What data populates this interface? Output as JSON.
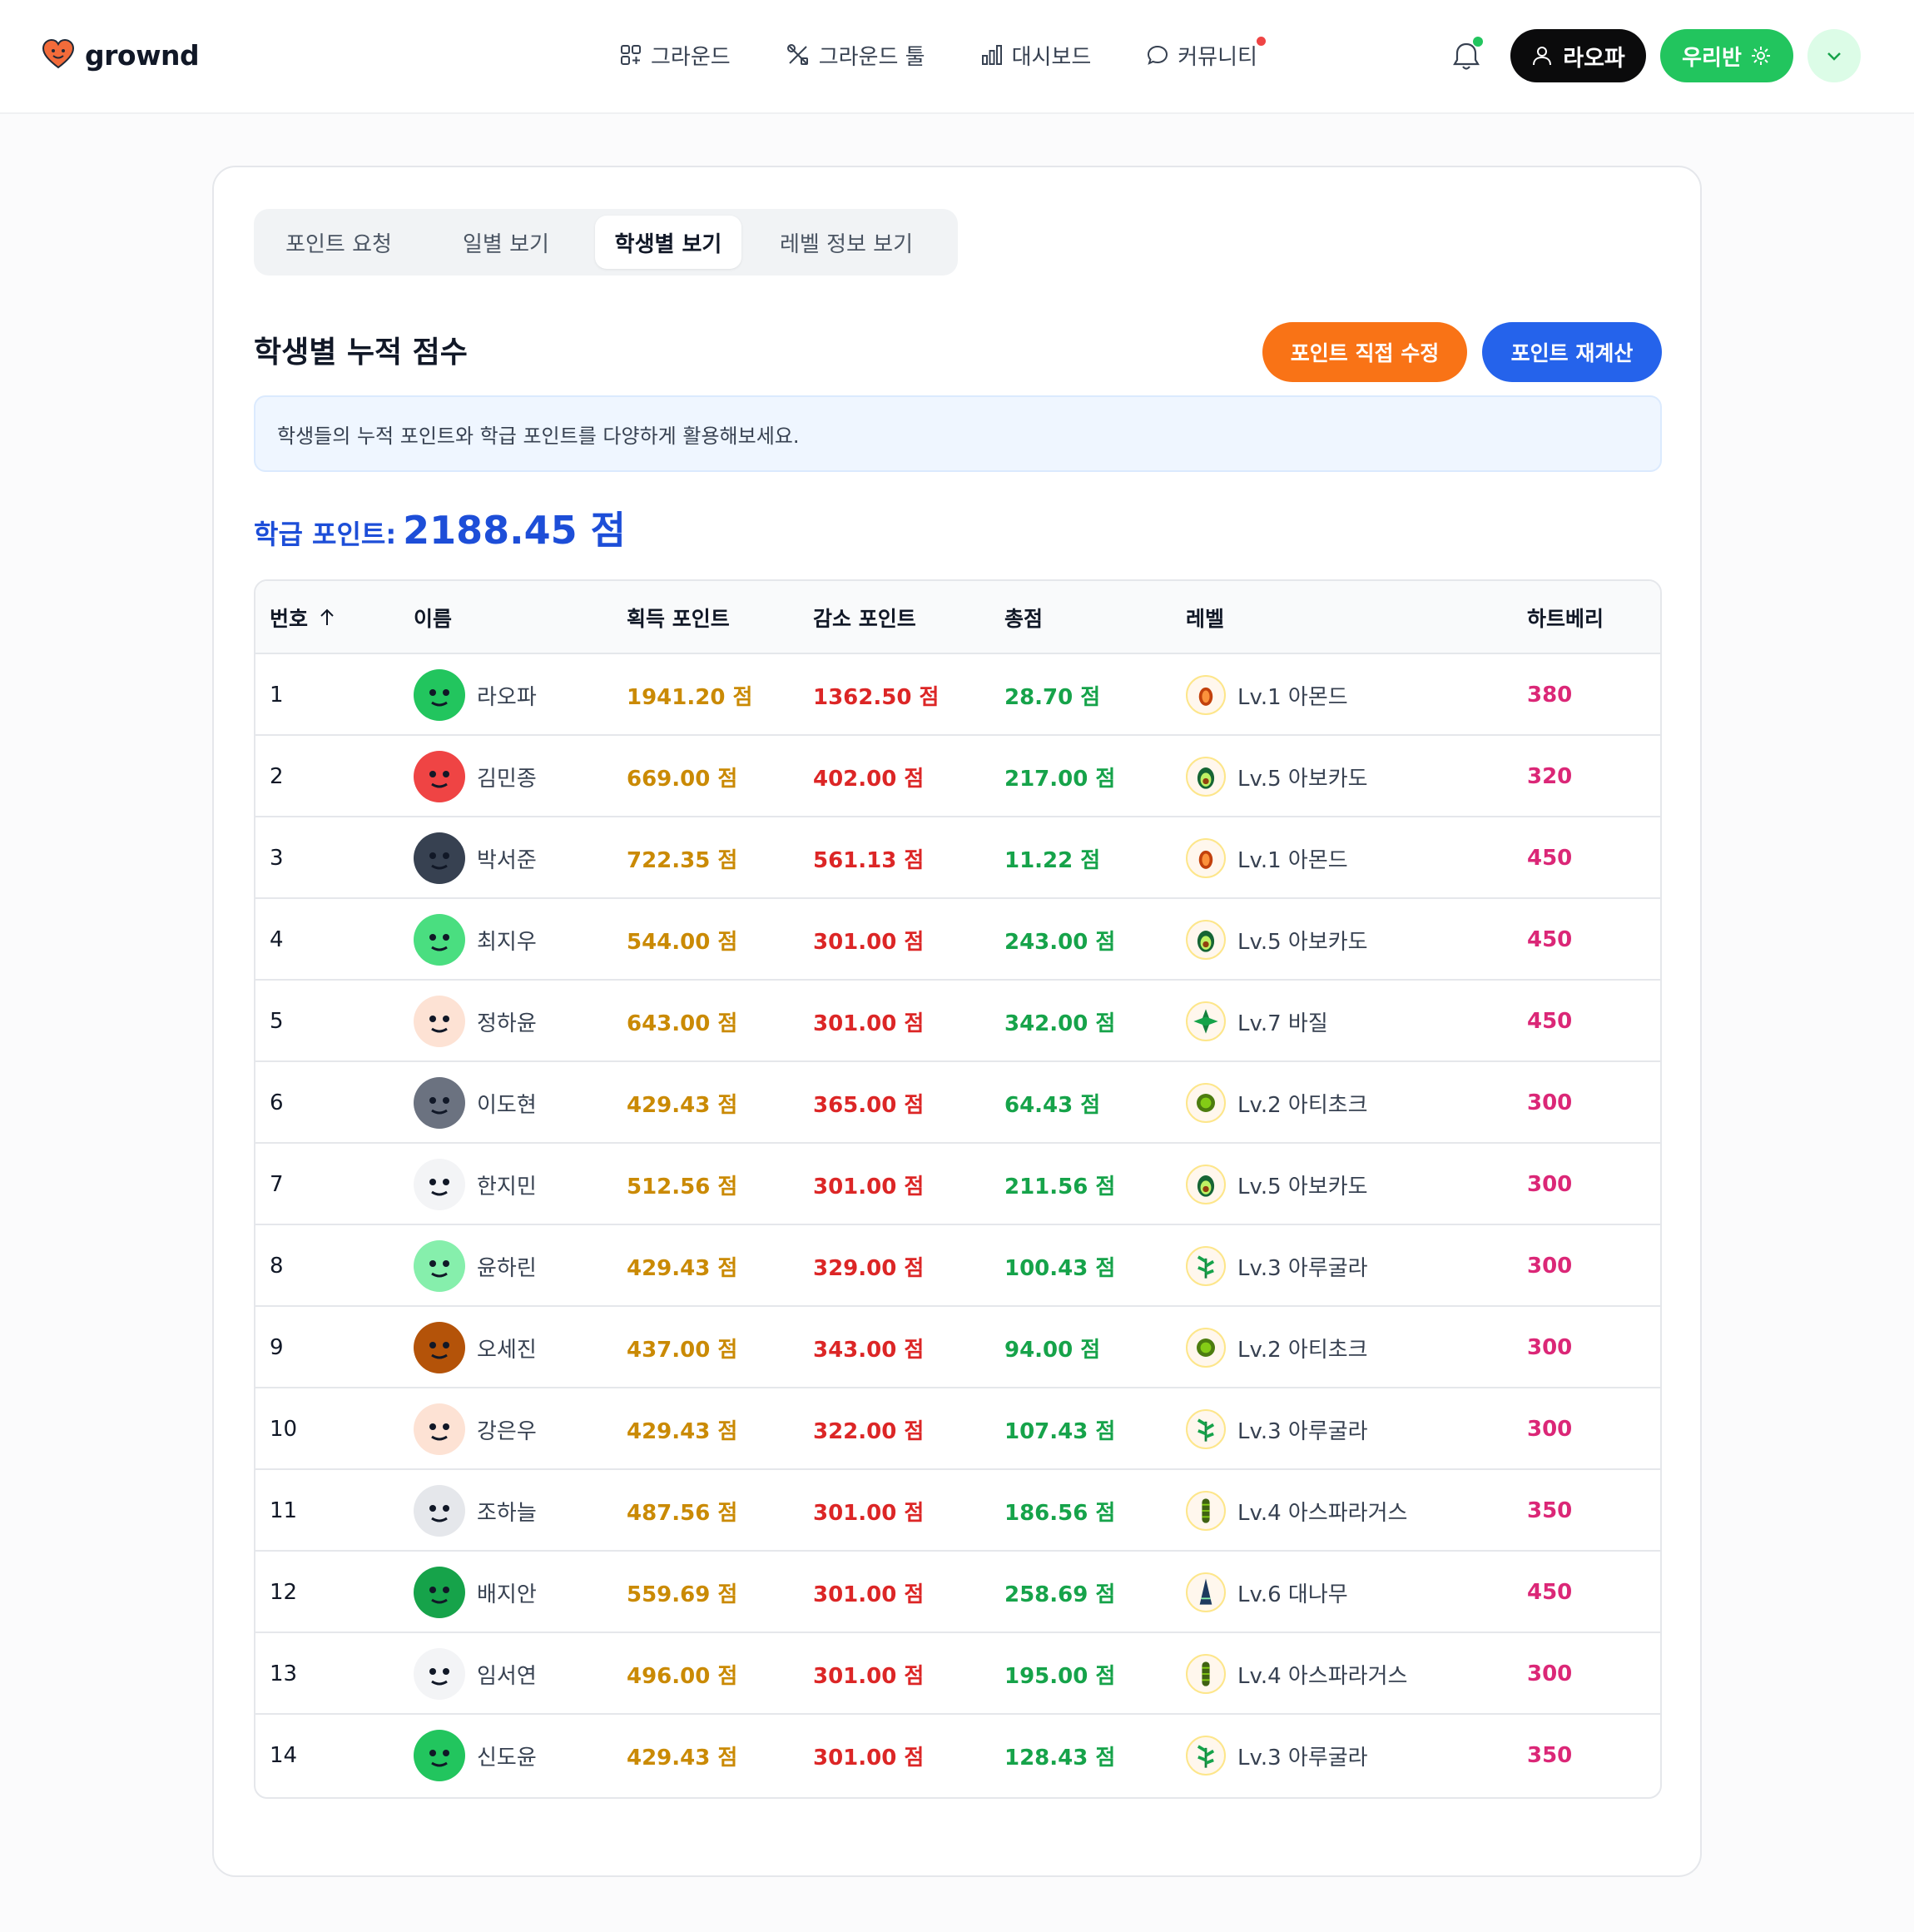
{
  "header": {
    "brand": "grownd",
    "nav": [
      {
        "label": "그라운드",
        "icon": "grid-icon"
      },
      {
        "label": "그라운드 툴",
        "icon": "tools-icon"
      },
      {
        "label": "대시보드",
        "icon": "bar-chart-icon"
      },
      {
        "label": "커뮤니티",
        "icon": "chat-bubble-icon"
      }
    ],
    "user_label": "라오파",
    "class_label": "우리반"
  },
  "tabs": [
    "포인트 요청",
    "일별 보기",
    "학생별 보기",
    "레벨 정보 보기"
  ],
  "active_tab": 2,
  "section": {
    "title": "학생별 누적 점수",
    "edit_button": "포인트 직접 수정",
    "recalc_button": "포인트 재계산",
    "info": "학생들의 누적 포인트와 학급 포인트를 다양하게 활용해보세요.",
    "class_points_label": "학급 포인트:",
    "class_points_value": "2188.45 점"
  },
  "table": {
    "columns": {
      "no": "번호",
      "name": "이름",
      "gain": "획득 포인트",
      "loss": "감소 포인트",
      "total": "총점",
      "level": "레벨",
      "heart": "하트베리"
    },
    "rows": [
      {
        "no": "1",
        "name": "라오파",
        "gain": "1941.20 점",
        "loss": "1362.50 점",
        "total": "28.70 점",
        "level": "Lv.1 아몬드",
        "heart": "380",
        "avatar": "#22c55e",
        "lvl": "almond"
      },
      {
        "no": "2",
        "name": "김민종",
        "gain": "669.00 점",
        "loss": "402.00 점",
        "total": "217.00 점",
        "level": "Lv.5 아보카도",
        "heart": "320",
        "avatar": "#ef4444",
        "lvl": "avocado"
      },
      {
        "no": "3",
        "name": "박서준",
        "gain": "722.35 점",
        "loss": "561.13 점",
        "total": "11.22 점",
        "level": "Lv.1 아몬드",
        "heart": "450",
        "avatar": "#374151",
        "lvl": "almond"
      },
      {
        "no": "4",
        "name": "최지우",
        "gain": "544.00 점",
        "loss": "301.00 점",
        "total": "243.00 점",
        "level": "Lv.5 아보카도",
        "heart": "450",
        "avatar": "#4ade80",
        "lvl": "avocado"
      },
      {
        "no": "5",
        "name": "정하윤",
        "gain": "643.00 점",
        "loss": "301.00 점",
        "total": "342.00 점",
        "level": "Lv.7 바질",
        "heart": "450",
        "avatar": "#fde2d4",
        "lvl": "basil"
      },
      {
        "no": "6",
        "name": "이도현",
        "gain": "429.43 점",
        "loss": "365.00 점",
        "total": "64.43 점",
        "level": "Lv.2 아티초크",
        "heart": "300",
        "avatar": "#6b7280",
        "lvl": "artichoke"
      },
      {
        "no": "7",
        "name": "한지민",
        "gain": "512.56 점",
        "loss": "301.00 점",
        "total": "211.56 점",
        "level": "Lv.5 아보카도",
        "heart": "300",
        "avatar": "#f3f4f6",
        "lvl": "avocado"
      },
      {
        "no": "8",
        "name": "윤하린",
        "gain": "429.43 점",
        "loss": "329.00 점",
        "total": "100.43 점",
        "level": "Lv.3 아루굴라",
        "heart": "300",
        "avatar": "#86efac",
        "lvl": "arugula"
      },
      {
        "no": "9",
        "name": "오세진",
        "gain": "437.00 점",
        "loss": "343.00 점",
        "total": "94.00 점",
        "level": "Lv.2 아티초크",
        "heart": "300",
        "avatar": "#b45309",
        "lvl": "artichoke"
      },
      {
        "no": "10",
        "name": "강은우",
        "gain": "429.43 점",
        "loss": "322.00 점",
        "total": "107.43 점",
        "level": "Lv.3 아루굴라",
        "heart": "300",
        "avatar": "#fde2d4",
        "lvl": "arugula"
      },
      {
        "no": "11",
        "name": "조하늘",
        "gain": "487.56 점",
        "loss": "301.00 점",
        "total": "186.56 점",
        "level": "Lv.4 아스파라거스",
        "heart": "350",
        "avatar": "#e5e7eb",
        "lvl": "asparagus"
      },
      {
        "no": "12",
        "name": "배지안",
        "gain": "559.69 점",
        "loss": "301.00 점",
        "total": "258.69 점",
        "level": "Lv.6 대나무",
        "heart": "450",
        "avatar": "#16a34a",
        "lvl": "bamboo"
      },
      {
        "no": "13",
        "name": "임서연",
        "gain": "496.00 점",
        "loss": "301.00 점",
        "total": "195.00 점",
        "level": "Lv.4 아스파라거스",
        "heart": "300",
        "avatar": "#f3f4f6",
        "lvl": "asparagus"
      },
      {
        "no": "14",
        "name": "신도윤",
        "gain": "429.43 점",
        "loss": "301.00 점",
        "total": "128.43 점",
        "level": "Lv.3 아루굴라",
        "heart": "350",
        "avatar": "#22c55e",
        "lvl": "arugula"
      }
    ]
  },
  "colors": {
    "brand": "#f97316",
    "green": "#22c55e",
    "blue": "#2563eb"
  }
}
